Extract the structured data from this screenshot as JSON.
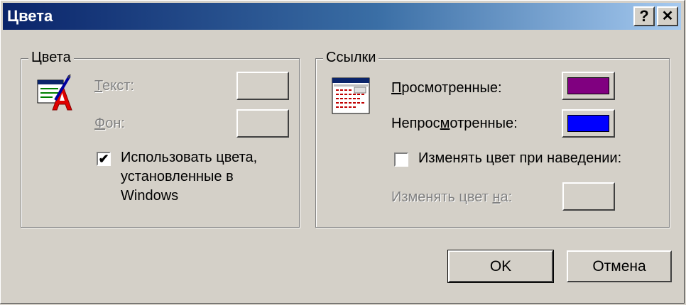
{
  "window": {
    "title": "Цвета",
    "help_button": "?",
    "close_button": "✕"
  },
  "colors_group": {
    "title": "Цвета",
    "icon": "text-color-icon",
    "text_label_prefix": "Т",
    "text_label_rest": "екст:",
    "background_label_prefix": "Ф",
    "background_label_rest": "он:",
    "use_windows_colors": {
      "checked": true,
      "label_line1": "Использовать цвета,",
      "label_line2": "установленные в",
      "label_line3": "Windows"
    }
  },
  "links_group": {
    "title": "Ссылки",
    "icon": "web-page-icon",
    "visited_label_prefix": "П",
    "visited_label_rest": "росмотренные:",
    "visited_color": "#800080",
    "unvisited_label_a": "Непрос",
    "unvisited_label_u": "м",
    "unvisited_label_b": "отренные:",
    "unvisited_color": "#0000ff",
    "hover": {
      "checked": false,
      "label_a": "Изменять цвет при наве",
      "label_u": "д",
      "label_b": "ении:"
    },
    "hover_color_label_a": "Изменять цвет ",
    "hover_color_label_u": "н",
    "hover_color_label_b": "а:"
  },
  "buttons": {
    "ok": "OK",
    "cancel": "Отмена"
  }
}
